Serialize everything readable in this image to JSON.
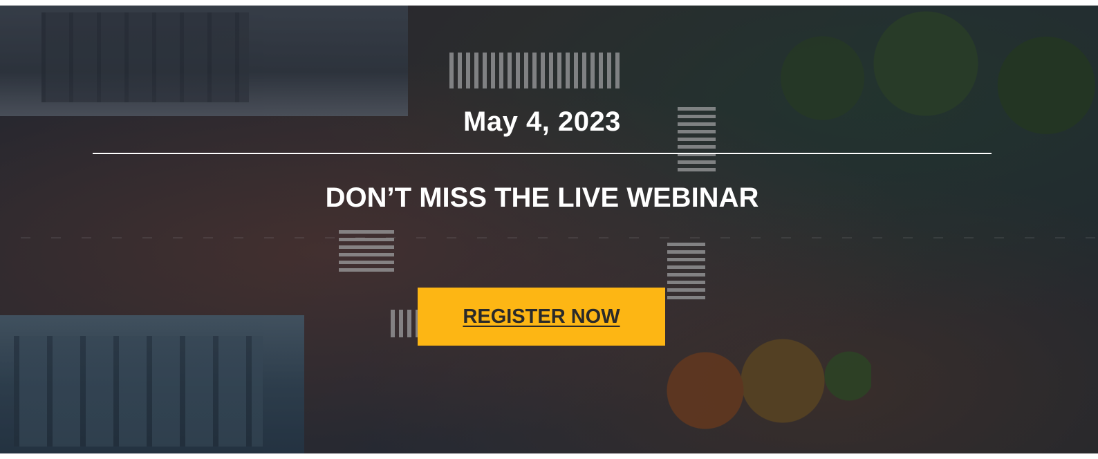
{
  "banner": {
    "date": "May 4, 2023",
    "headline": "DON’T MISS THE LIVE WEBINAR",
    "cta_label": "REGISTER NOW",
    "colors": {
      "cta_background": "#fdb614",
      "cta_text": "#2a2a2a",
      "text": "#ffffff"
    }
  }
}
